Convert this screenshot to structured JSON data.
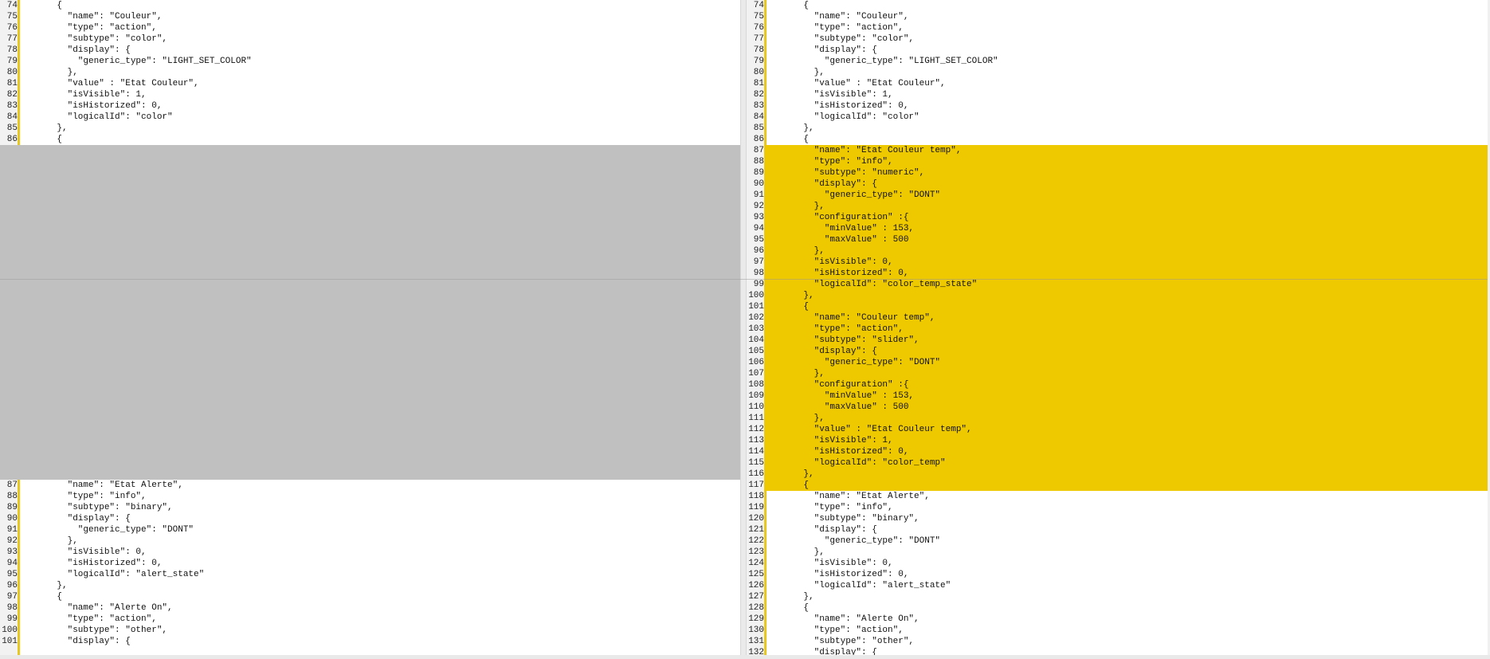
{
  "left_pane": {
    "lines": [
      {
        "n": "74",
        "code": "    {",
        "kind": "normal"
      },
      {
        "n": "75",
        "code": "      \"name\": \"Couleur\",",
        "kind": "normal"
      },
      {
        "n": "76",
        "code": "      \"type\": \"action\",",
        "kind": "normal"
      },
      {
        "n": "77",
        "code": "      \"subtype\": \"color\",",
        "kind": "normal"
      },
      {
        "n": "78",
        "code": "      \"display\": {",
        "kind": "normal"
      },
      {
        "n": "79",
        "code": "        \"generic_type\": \"LIGHT_SET_COLOR\"",
        "kind": "normal"
      },
      {
        "n": "80",
        "code": "      },",
        "kind": "normal"
      },
      {
        "n": "81",
        "code": "      \"value\" : \"Etat Couleur\",",
        "kind": "normal"
      },
      {
        "n": "82",
        "code": "      \"isVisible\": 1,",
        "kind": "normal"
      },
      {
        "n": "83",
        "code": "      \"isHistorized\": 0,",
        "kind": "normal"
      },
      {
        "n": "84",
        "code": "      \"logicalId\": \"color\"",
        "kind": "normal"
      },
      {
        "n": "85",
        "code": "    },",
        "kind": "normal"
      },
      {
        "n": "86",
        "code": "    {",
        "kind": "normal"
      },
      {
        "n": "",
        "code": "",
        "kind": "placeholder"
      },
      {
        "n": "",
        "code": "",
        "kind": "placeholder"
      },
      {
        "n": "",
        "code": "",
        "kind": "placeholder"
      },
      {
        "n": "",
        "code": "",
        "kind": "placeholder"
      },
      {
        "n": "",
        "code": "",
        "kind": "placeholder"
      },
      {
        "n": "",
        "code": "",
        "kind": "placeholder"
      },
      {
        "n": "",
        "code": "",
        "kind": "placeholder"
      },
      {
        "n": "",
        "code": "",
        "kind": "placeholder"
      },
      {
        "n": "",
        "code": "",
        "kind": "placeholder"
      },
      {
        "n": "",
        "code": "",
        "kind": "placeholder"
      },
      {
        "n": "",
        "code": "",
        "kind": "placeholder"
      },
      {
        "n": "",
        "code": "",
        "kind": "placeholder"
      },
      {
        "n": "",
        "code": "",
        "kind": "placeholder"
      },
      {
        "n": "",
        "code": "",
        "kind": "placeholder"
      },
      {
        "n": "",
        "code": "",
        "kind": "placeholder"
      },
      {
        "n": "",
        "code": "",
        "kind": "placeholder"
      },
      {
        "n": "",
        "code": "",
        "kind": "placeholder"
      },
      {
        "n": "",
        "code": "",
        "kind": "placeholder"
      },
      {
        "n": "",
        "code": "",
        "kind": "placeholder"
      },
      {
        "n": "",
        "code": "",
        "kind": "placeholder"
      },
      {
        "n": "",
        "code": "",
        "kind": "placeholder"
      },
      {
        "n": "",
        "code": "",
        "kind": "placeholder"
      },
      {
        "n": "",
        "code": "",
        "kind": "placeholder"
      },
      {
        "n": "",
        "code": "",
        "kind": "placeholder"
      },
      {
        "n": "",
        "code": "",
        "kind": "placeholder"
      },
      {
        "n": "",
        "code": "",
        "kind": "placeholder"
      },
      {
        "n": "",
        "code": "",
        "kind": "placeholder"
      },
      {
        "n": "",
        "code": "",
        "kind": "placeholder"
      },
      {
        "n": "",
        "code": "",
        "kind": "placeholder"
      },
      {
        "n": "",
        "code": "",
        "kind": "placeholder"
      },
      {
        "n": "87",
        "code": "      \"name\": \"Etat Alerte\",",
        "kind": "normal"
      },
      {
        "n": "88",
        "code": "      \"type\": \"info\",",
        "kind": "normal"
      },
      {
        "n": "89",
        "code": "      \"subtype\": \"binary\",",
        "kind": "normal"
      },
      {
        "n": "90",
        "code": "      \"display\": {",
        "kind": "normal"
      },
      {
        "n": "91",
        "code": "        \"generic_type\": \"DONT\"",
        "kind": "normal"
      },
      {
        "n": "92",
        "code": "      },",
        "kind": "normal"
      },
      {
        "n": "93",
        "code": "      \"isVisible\": 0,",
        "kind": "normal"
      },
      {
        "n": "94",
        "code": "      \"isHistorized\": 0,",
        "kind": "normal"
      },
      {
        "n": "95",
        "code": "      \"logicalId\": \"alert_state\"",
        "kind": "normal"
      },
      {
        "n": "96",
        "code": "    },",
        "kind": "normal"
      },
      {
        "n": "97",
        "code": "    {",
        "kind": "normal"
      },
      {
        "n": "98",
        "code": "      \"name\": \"Alerte On\",",
        "kind": "normal"
      },
      {
        "n": "99",
        "code": "      \"type\": \"action\",",
        "kind": "normal"
      },
      {
        "n": "100",
        "code": "      \"subtype\": \"other\",",
        "kind": "normal"
      },
      {
        "n": "101",
        "code": "      \"display\": {",
        "kind": "normal"
      }
    ]
  },
  "right_pane": {
    "lines": [
      {
        "n": "74",
        "code": "    {",
        "kind": "normal"
      },
      {
        "n": "75",
        "code": "      \"name\": \"Couleur\",",
        "kind": "normal"
      },
      {
        "n": "76",
        "code": "      \"type\": \"action\",",
        "kind": "normal"
      },
      {
        "n": "77",
        "code": "      \"subtype\": \"color\",",
        "kind": "normal"
      },
      {
        "n": "78",
        "code": "      \"display\": {",
        "kind": "normal"
      },
      {
        "n": "79",
        "code": "        \"generic_type\": \"LIGHT_SET_COLOR\"",
        "kind": "normal"
      },
      {
        "n": "80",
        "code": "      },",
        "kind": "normal"
      },
      {
        "n": "81",
        "code": "      \"value\" : \"Etat Couleur\",",
        "kind": "normal"
      },
      {
        "n": "82",
        "code": "      \"isVisible\": 1,",
        "kind": "normal"
      },
      {
        "n": "83",
        "code": "      \"isHistorized\": 0,",
        "kind": "normal"
      },
      {
        "n": "84",
        "code": "      \"logicalId\": \"color\"",
        "kind": "normal"
      },
      {
        "n": "85",
        "code": "    },",
        "kind": "normal"
      },
      {
        "n": "86",
        "code": "    {",
        "kind": "normal"
      },
      {
        "n": "87",
        "code": "      \"name\": \"Etat Couleur temp\",",
        "kind": "added"
      },
      {
        "n": "88",
        "code": "      \"type\": \"info\",",
        "kind": "added"
      },
      {
        "n": "89",
        "code": "      \"subtype\": \"numeric\",",
        "kind": "added"
      },
      {
        "n": "90",
        "code": "      \"display\": {",
        "kind": "added"
      },
      {
        "n": "91",
        "code": "        \"generic_type\": \"DONT\"",
        "kind": "added"
      },
      {
        "n": "92",
        "code": "      },",
        "kind": "added"
      },
      {
        "n": "93",
        "code": "      \"configuration\" :{",
        "kind": "added"
      },
      {
        "n": "94",
        "code": "        \"minValue\" : 153,",
        "kind": "added"
      },
      {
        "n": "95",
        "code": "        \"maxValue\" : 500",
        "kind": "added"
      },
      {
        "n": "96",
        "code": "      },",
        "kind": "added"
      },
      {
        "n": "97",
        "code": "      \"isVisible\": 0,",
        "kind": "added"
      },
      {
        "n": "98",
        "code": "      \"isHistorized\": 0,",
        "kind": "added"
      },
      {
        "n": "99",
        "code": "      \"logicalId\": \"color_temp_state\"",
        "kind": "added"
      },
      {
        "n": "100",
        "code": "    },",
        "kind": "added"
      },
      {
        "n": "101",
        "code": "    {",
        "kind": "added"
      },
      {
        "n": "102",
        "code": "      \"name\": \"Couleur temp\",",
        "kind": "added"
      },
      {
        "n": "103",
        "code": "      \"type\": \"action\",",
        "kind": "added"
      },
      {
        "n": "104",
        "code": "      \"subtype\": \"slider\",",
        "kind": "added"
      },
      {
        "n": "105",
        "code": "      \"display\": {",
        "kind": "added"
      },
      {
        "n": "106",
        "code": "        \"generic_type\": \"DONT\"",
        "kind": "added"
      },
      {
        "n": "107",
        "code": "      },",
        "kind": "added"
      },
      {
        "n": "108",
        "code": "      \"configuration\" :{",
        "kind": "added"
      },
      {
        "n": "109",
        "code": "        \"minValue\" : 153,",
        "kind": "added"
      },
      {
        "n": "110",
        "code": "        \"maxValue\" : 500",
        "kind": "added"
      },
      {
        "n": "111",
        "code": "      },",
        "kind": "added"
      },
      {
        "n": "112",
        "code": "      \"value\" : \"Etat Couleur temp\",",
        "kind": "added"
      },
      {
        "n": "113",
        "code": "      \"isVisible\": 1,",
        "kind": "added"
      },
      {
        "n": "114",
        "code": "      \"isHistorized\": 0,",
        "kind": "added"
      },
      {
        "n": "115",
        "code": "      \"logicalId\": \"color_temp\"",
        "kind": "added"
      },
      {
        "n": "116",
        "code": "    },",
        "kind": "added"
      },
      {
        "n": "117",
        "code": "    {",
        "kind": "added"
      },
      {
        "n": "118",
        "code": "      \"name\": \"Etat Alerte\",",
        "kind": "normal"
      },
      {
        "n": "119",
        "code": "      \"type\": \"info\",",
        "kind": "normal"
      },
      {
        "n": "120",
        "code": "      \"subtype\": \"binary\",",
        "kind": "normal"
      },
      {
        "n": "121",
        "code": "      \"display\": {",
        "kind": "normal"
      },
      {
        "n": "122",
        "code": "        \"generic_type\": \"DONT\"",
        "kind": "normal"
      },
      {
        "n": "123",
        "code": "      },",
        "kind": "normal"
      },
      {
        "n": "124",
        "code": "      \"isVisible\": 0,",
        "kind": "normal"
      },
      {
        "n": "125",
        "code": "      \"isHistorized\": 0,",
        "kind": "normal"
      },
      {
        "n": "126",
        "code": "      \"logicalId\": \"alert_state\"",
        "kind": "normal"
      },
      {
        "n": "127",
        "code": "    },",
        "kind": "normal"
      },
      {
        "n": "128",
        "code": "    {",
        "kind": "normal"
      },
      {
        "n": "129",
        "code": "      \"name\": \"Alerte On\",",
        "kind": "normal"
      },
      {
        "n": "130",
        "code": "      \"type\": \"action\",",
        "kind": "normal"
      },
      {
        "n": "131",
        "code": "      \"subtype\": \"other\",",
        "kind": "normal"
      },
      {
        "n": "132",
        "code": "      \"display\": {",
        "kind": "normal"
      }
    ]
  },
  "colors": {
    "added_background": "#eec900",
    "placeholder_background": "#c0c0c0",
    "change_bar": "#e6c81e"
  }
}
